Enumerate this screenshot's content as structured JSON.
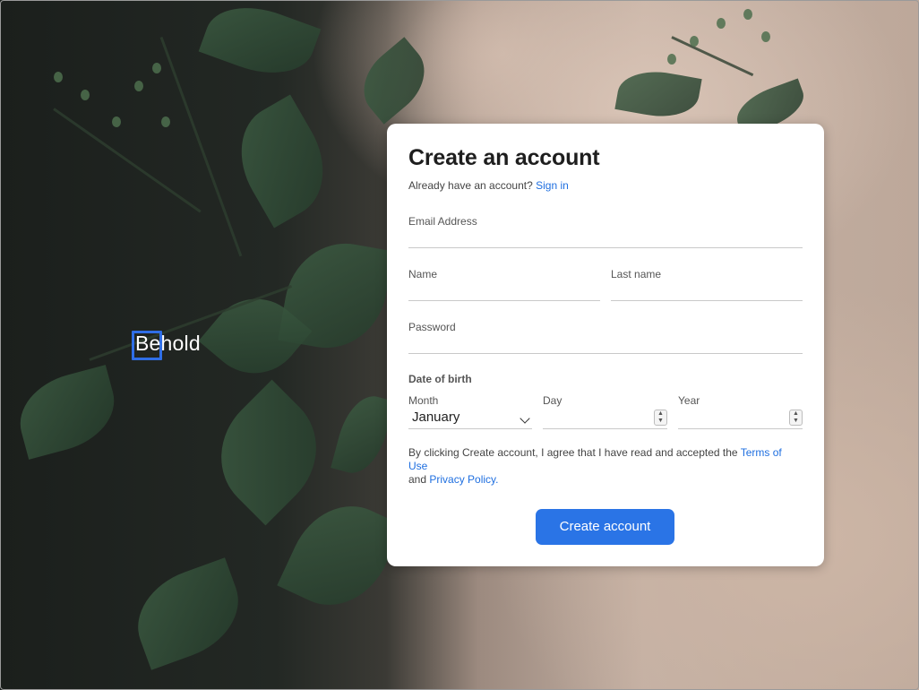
{
  "brand": {
    "name": "Behold"
  },
  "form": {
    "title": "Create an account",
    "signin_prompt": "Already have an account?",
    "signin_link": "Sign in",
    "email_label": "Email Address",
    "email_value": "",
    "name_label": "Name",
    "name_value": "",
    "last_name_label": "Last name",
    "last_name_value": "",
    "password_label": "Password",
    "password_value": "",
    "dob_label": "Date of birth",
    "month_label": "Month",
    "month_value": "January",
    "day_label": "Day",
    "day_value": "",
    "year_label": "Year",
    "year_value": "",
    "terms_prefix": "By clicking Create account, I agree that I have read and accepted the",
    "terms_link": "Terms of Use",
    "terms_and": "and",
    "privacy_link": "Privacy Policy.",
    "submit_label": "Create account"
  },
  "colors": {
    "accent": "#2a74e6",
    "link": "#1f6fe0",
    "card_bg": "#ffffff",
    "focus_box": "#2f6ee6"
  }
}
